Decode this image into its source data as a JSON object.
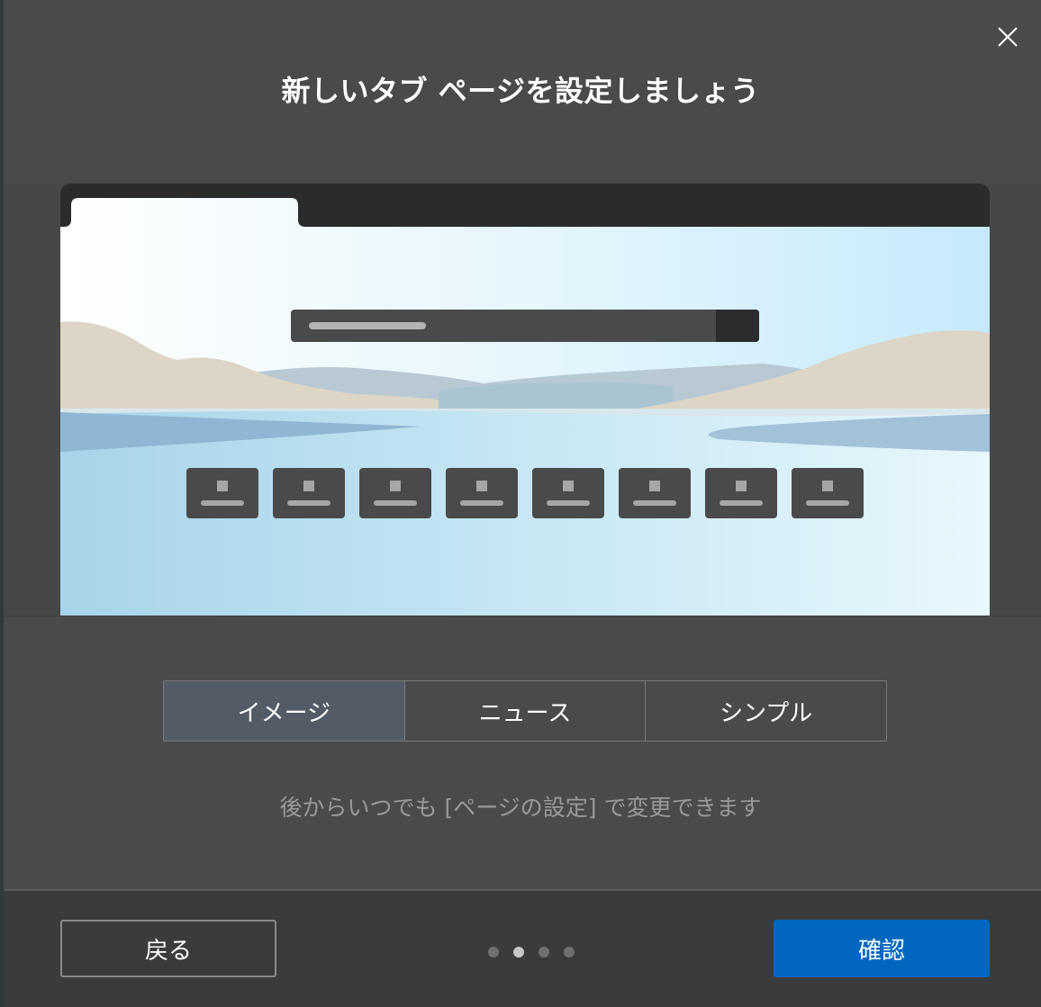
{
  "dialog": {
    "title": "新しいタブ ページを設定しましょう",
    "close_icon": "close-icon"
  },
  "preview": {
    "description_tab": "browser-tab-preview",
    "search_icon": "search-bar",
    "quick_link_count": 8
  },
  "layout_options": {
    "selected": "イメージ",
    "options": [
      {
        "label": "イメージ"
      },
      {
        "label": "ニュース"
      },
      {
        "label": "シンプル"
      }
    ]
  },
  "hint": "後からいつでも [ページの設定] で変更できます",
  "footer": {
    "back_label": "戻る",
    "confirm_label": "確認",
    "page_count": 4,
    "current_page": 2
  },
  "colors": {
    "accent": "#0067c0",
    "selected_segment": "#535c66",
    "dialog_bg": "#4a4a4a"
  }
}
